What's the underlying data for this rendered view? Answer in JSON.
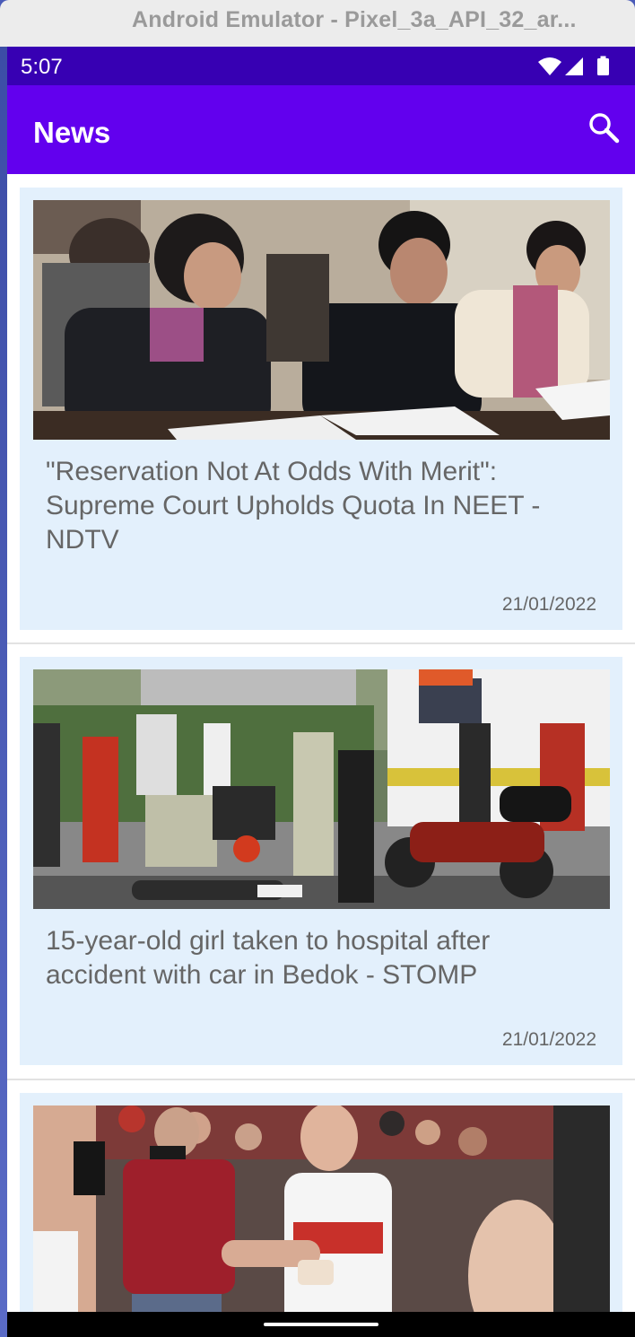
{
  "window": {
    "title": "Android Emulator - Pixel_3a_API_32_ar..."
  },
  "status_bar": {
    "time": "5:07"
  },
  "app_bar": {
    "title": "News"
  },
  "articles": [
    {
      "title": "\"Reservation Not At Odds With Merit\": Supreme Court Upholds Quota In NEET - NDTV",
      "date": "21/01/2022",
      "image": "students-writing-exam-photo"
    },
    {
      "title": "15-year-old girl taken to hospital after accident with car in Bedok - STOMP",
      "date": "21/01/2022",
      "image": "road-accident-scene-photo"
    },
    {
      "title": "",
      "date": "",
      "image": "basketball-player-celebrating-photo"
    }
  ],
  "colors": {
    "status_bar": "#3700b3",
    "app_bar": "#6200ee",
    "card_background": "#e3f0fc",
    "text": "#666666"
  }
}
